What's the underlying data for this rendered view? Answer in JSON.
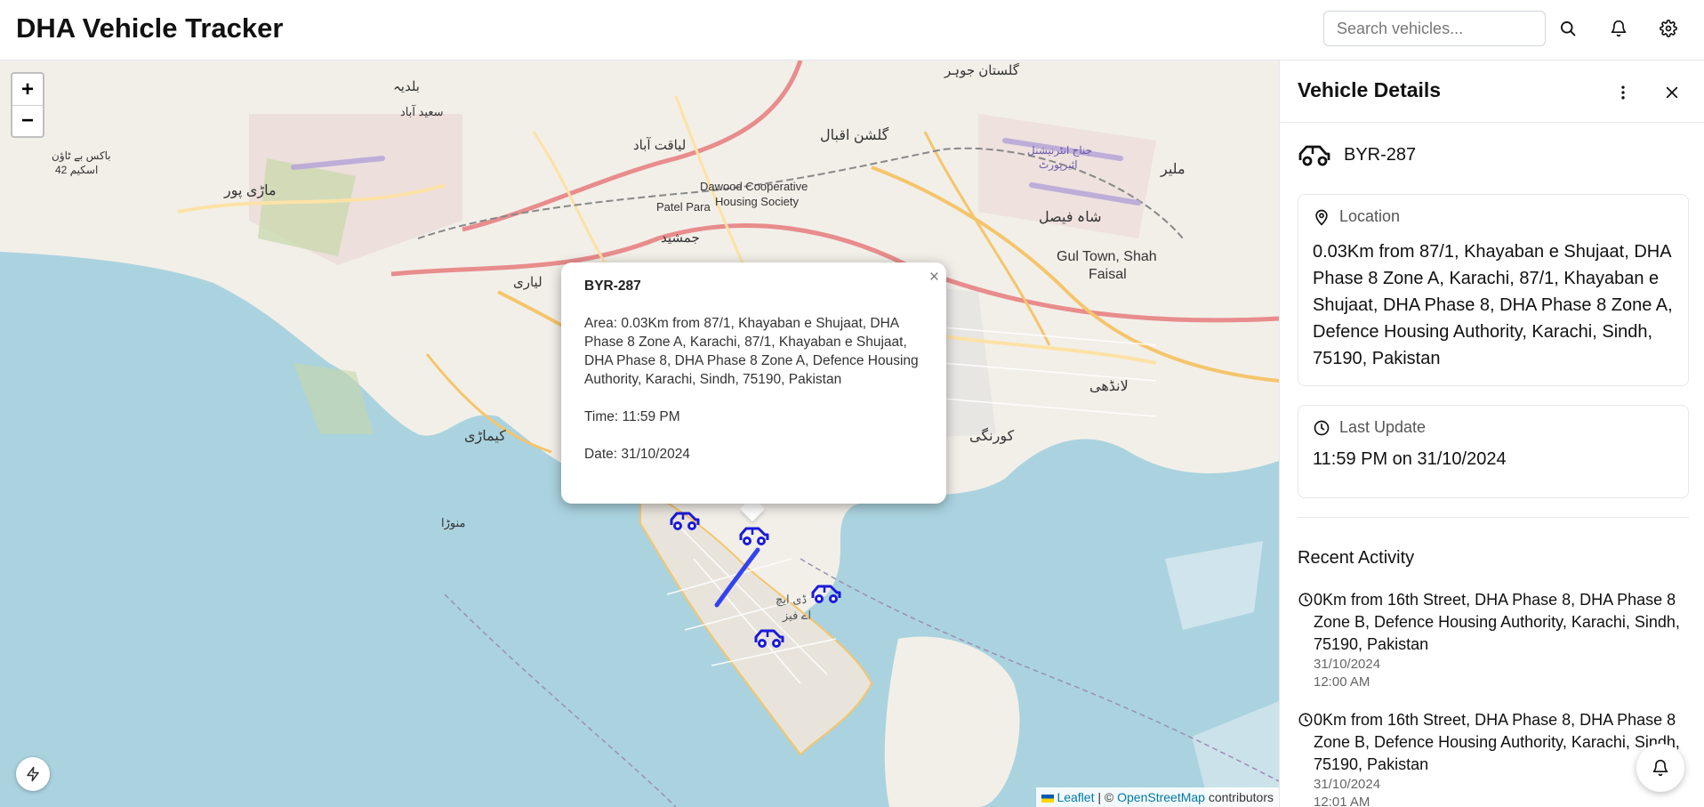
{
  "app": {
    "title": "DHA Vehicle Tracker"
  },
  "header": {
    "search_placeholder": "Search vehicles...",
    "icons": [
      "search-icon",
      "bell-icon",
      "gear-icon"
    ]
  },
  "map": {
    "zoom_in": "+",
    "zoom_out": "−",
    "popup": {
      "title": "BYR-287",
      "area": "Area: 0.03Km from 87/1, Khayaban e Shujaat, DHA Phase 8 Zone A, Karachi, 87/1, Khayaban e Shujaat, DHA Phase 8, DHA Phase 8 Zone A, Defence Housing Authority, Karachi, Sindh, 75190, Pakistan",
      "time": "Time: 11:59 PM",
      "date": "Date: 31/10/2024",
      "close": "×"
    },
    "attribution": {
      "leaflet": "Leaflet",
      "sep": "| ©",
      "osm": "OpenStreetMap",
      "suffix": "contributors"
    },
    "place_labels": {
      "dawood": "Dawood Cooperative",
      "dawood2": "Housing Society",
      "patel": "Patel Para",
      "gul": "Gul Town, Shah",
      "faisal": "Faisal",
      "baldia": "بلدیہ",
      "mauripur": "ماڑی پور",
      "korangi": "کورنگی",
      "landhi": "لانڈھی",
      "saeed": "سعید آباد",
      "gulshan": "گلشن اقبال",
      "kiamari": "کیماڑی",
      "manora": "منوڑا",
      "shahfaisal": "شاہ فیصل",
      "malir": "ملیر",
      "jauhar": "گلستان جوہر",
      "liaquat": "لیاقت آباد",
      "jamshed": "جمشید",
      "lyari": "لیاری",
      "airport": "جناح انٹرنیشنل",
      "airport2": "ائیرپورٹ",
      "baks": "باکس بے ٹاؤن",
      "baks2": "اسکیم 42",
      "dha": "ڈی ایچ",
      "dha2": "اے فیز"
    },
    "marker_color": "#1a1adb",
    "water_color": "#aad3df",
    "land_color": "#f2efe9"
  },
  "panel": {
    "title": "Vehicle Details",
    "vehicle": "BYR-287",
    "location_label": "Location",
    "location_value": "0.03Km from 87/1, Khayaban e Shujaat, DHA Phase 8 Zone A, Karachi, 87/1, Khayaban e Shujaat, DHA Phase 8, DHA Phase 8 Zone A, Defence Housing Authority, Karachi, Sindh, 75190, Pakistan",
    "update_label": "Last Update",
    "update_value": "11:59 PM on 31/10/2024",
    "recent_title": "Recent Activity",
    "activities": [
      {
        "text": "0Km from 16th Street, DHA Phase 8, DHA Phase 8 Zone B, Defence Housing Authority, Karachi, Sindh, 75190, Pakistan",
        "date": "31/10/2024",
        "time": "12:00 AM"
      },
      {
        "text": "0Km from 16th Street, DHA Phase 8, DHA Phase 8 Zone B, Defence Housing Authority, Karachi, Sindh, 75190, Pakistan",
        "date": "31/10/2024",
        "time": "12:01 AM"
      }
    ]
  }
}
